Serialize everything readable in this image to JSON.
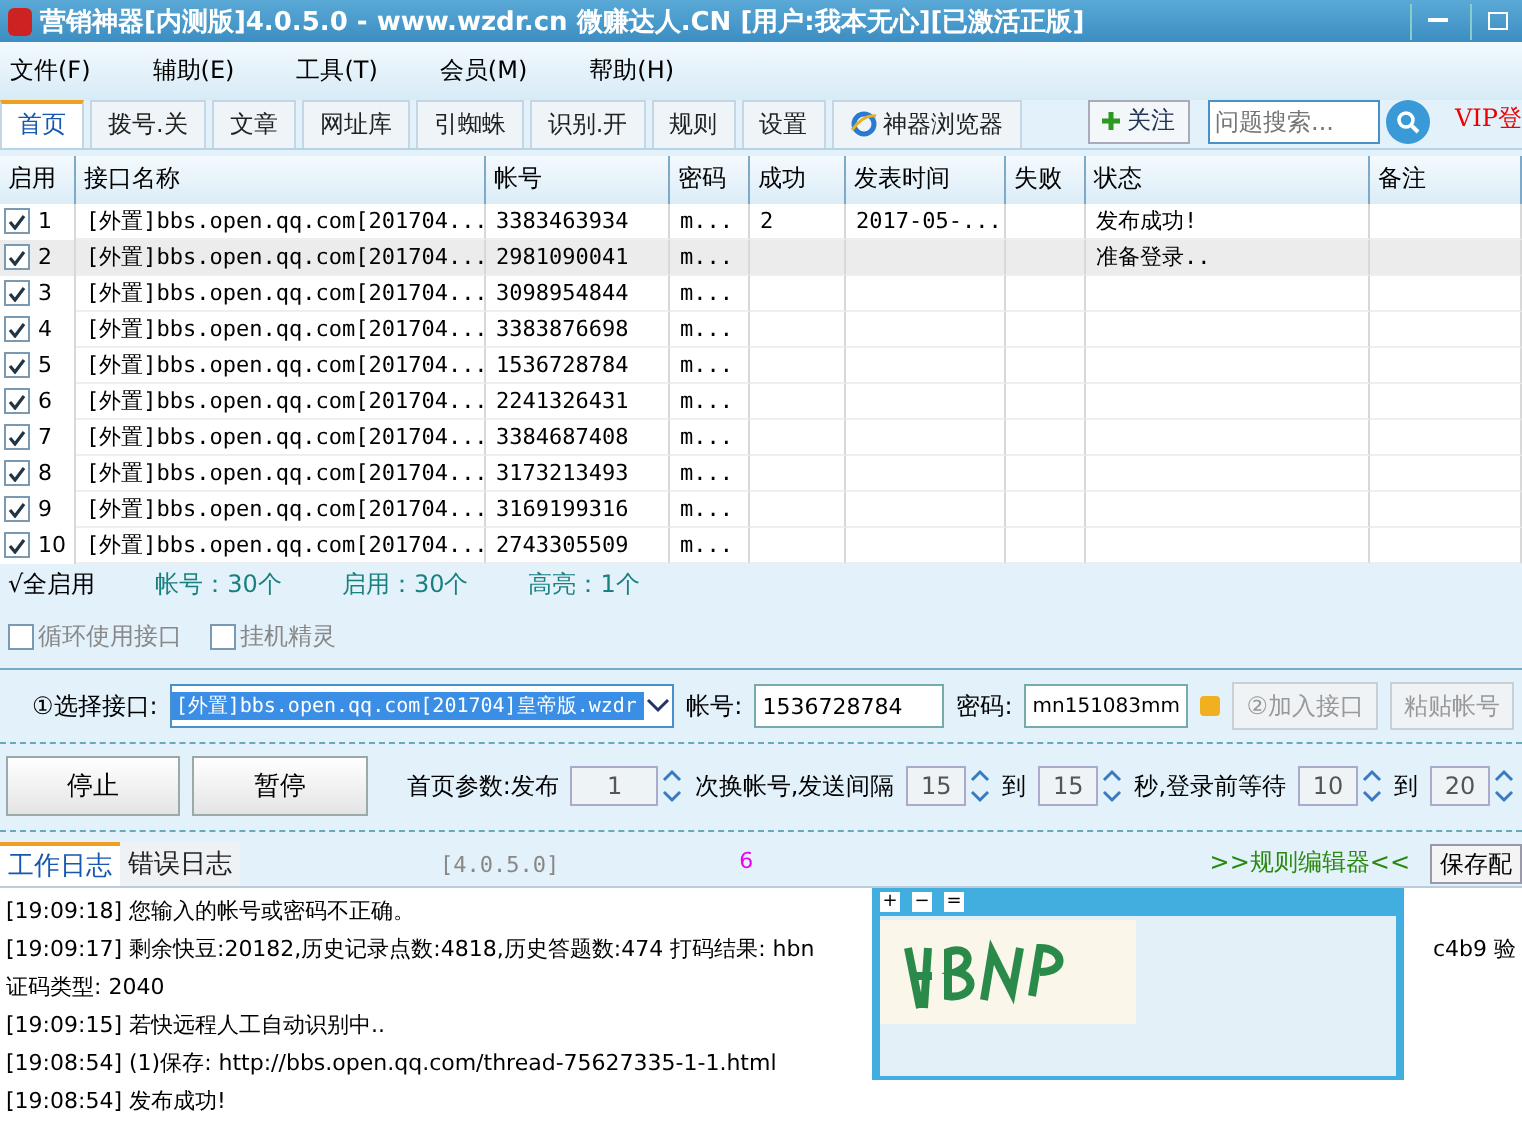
{
  "window": {
    "title": "营销神器[内测版]4.0.5.0 - www.wzdr.cn 微赚达人.CN [用户:我本无心][已激活正版]"
  },
  "menu": [
    "文件(F)",
    "辅助(E)",
    "工具(T)",
    "会员(M)",
    "帮助(H)"
  ],
  "tabs": [
    {
      "label": "首页",
      "selected": true,
      "kind": "text"
    },
    {
      "label": "拨号.关",
      "selected": false,
      "kind": "text"
    },
    {
      "label": "文章",
      "selected": false,
      "kind": "text"
    },
    {
      "label": "网址库",
      "selected": false,
      "kind": "text"
    },
    {
      "label": "引蜘蛛",
      "selected": false,
      "kind": "text"
    },
    {
      "label": "识别.开",
      "selected": false,
      "kind": "text"
    },
    {
      "label": "规则",
      "selected": false,
      "kind": "text"
    },
    {
      "label": "设置",
      "selected": false,
      "kind": "text"
    },
    {
      "label": "神器浏览器",
      "selected": false,
      "kind": "browser"
    }
  ],
  "follow_button": "关注",
  "search": {
    "placeholder": "问题搜索..."
  },
  "vip_link": "VIP登",
  "table": {
    "columns": [
      "启用",
      "接口名称",
      "帐号",
      "密码",
      "成功",
      "发表时间",
      "失败",
      "状态",
      "备注"
    ],
    "rows": [
      {
        "checked": true,
        "selected": false,
        "cells": [
          "1",
          "[外置]bbs.open.qq.com[201704...",
          "3383463934",
          "m...",
          "2",
          "2017-05-...",
          "",
          "发布成功!",
          ""
        ]
      },
      {
        "checked": true,
        "selected": true,
        "cells": [
          "2",
          "[外置]bbs.open.qq.com[201704...",
          "2981090041",
          "m...",
          "",
          "",
          "",
          "准备登录..",
          ""
        ]
      },
      {
        "checked": true,
        "selected": false,
        "cells": [
          "3",
          "[外置]bbs.open.qq.com[201704...",
          "3098954844",
          "m...",
          "",
          "",
          "",
          "",
          ""
        ]
      },
      {
        "checked": true,
        "selected": false,
        "cells": [
          "4",
          "[外置]bbs.open.qq.com[201704...",
          "3383876698",
          "m...",
          "",
          "",
          "",
          "",
          ""
        ]
      },
      {
        "checked": true,
        "selected": false,
        "cells": [
          "5",
          "[外置]bbs.open.qq.com[201704...",
          "1536728784",
          "m...",
          "",
          "",
          "",
          "",
          ""
        ]
      },
      {
        "checked": true,
        "selected": false,
        "cells": [
          "6",
          "[外置]bbs.open.qq.com[201704...",
          "2241326431",
          "m...",
          "",
          "",
          "",
          "",
          ""
        ]
      },
      {
        "checked": true,
        "selected": false,
        "cells": [
          "7",
          "[外置]bbs.open.qq.com[201704...",
          "3384687408",
          "m...",
          "",
          "",
          "",
          "",
          ""
        ]
      },
      {
        "checked": true,
        "selected": false,
        "cells": [
          "8",
          "[外置]bbs.open.qq.com[201704...",
          "3173213493",
          "m...",
          "",
          "",
          "",
          "",
          ""
        ]
      },
      {
        "checked": true,
        "selected": false,
        "cells": [
          "9",
          "[外置]bbs.open.qq.com[201704...",
          "3169199316",
          "m...",
          "",
          "",
          "",
          "",
          ""
        ]
      },
      {
        "checked": true,
        "selected": false,
        "cells": [
          "10",
          "[外置]bbs.open.qq.com[201704...",
          "2743305509",
          "m...",
          "",
          "",
          "",
          "",
          ""
        ]
      }
    ]
  },
  "summary": {
    "select_all": "√全启用",
    "stats": [
      "帐号：30个",
      "启用：30个",
      "高亮：1个"
    ]
  },
  "options": [
    {
      "label": "循环使用接口",
      "checked": false
    },
    {
      "label": "挂机精灵",
      "checked": false
    }
  ],
  "interface": {
    "label": "①选择接口:",
    "value": "[外置]bbs.open.qq.com[201704]皇帝版.wzdr",
    "account_label": "帐号:",
    "account": "1536728784",
    "password_label": "密码:",
    "password": "mn151083mm",
    "add_button": "②加入接口",
    "paste_button": "粘贴帐号"
  },
  "controls": {
    "stop": "停止",
    "pause": "暂停",
    "params": [
      {
        "kind": "label",
        "text": "首页参数:发布"
      },
      {
        "kind": "spin",
        "text": "1"
      },
      {
        "kind": "label",
        "text": "次换帐号,发送间隔"
      },
      {
        "kind": "spin",
        "text": "15"
      },
      {
        "kind": "label",
        "text": "到"
      },
      {
        "kind": "spin",
        "text": "15"
      },
      {
        "kind": "label",
        "text": "秒,登录前等待"
      },
      {
        "kind": "spin",
        "text": "10"
      },
      {
        "kind": "label",
        "text": "到"
      },
      {
        "kind": "spin",
        "text": "20"
      }
    ]
  },
  "log_tabs": [
    {
      "label": "工作日志",
      "selected": true
    },
    {
      "label": "错误日志",
      "selected": false
    }
  ],
  "version": "[4.0.5.0]",
  "counter": "6",
  "rule_editor": ">>规则编辑器<<",
  "save_button": "保存配",
  "log": [
    "[19:09:18] 您输入的帐号或密码不正确。",
    "[19:09:17] 剩余快豆:20182,历史记录点数:4818,历史答题数:474 打码结果: hbn",
    "c4b9 验",
    "证码类型: 2040",
    "[19:09:15] 若快远程人工自动识别中..",
    "[19:08:54] (1)保存: http://bbs.open.qq.com/thread-75627335-1-1.html",
    "[19:08:54] 发布成功!"
  ],
  "captcha": {
    "controls": [
      "+",
      "−",
      "="
    ]
  }
}
